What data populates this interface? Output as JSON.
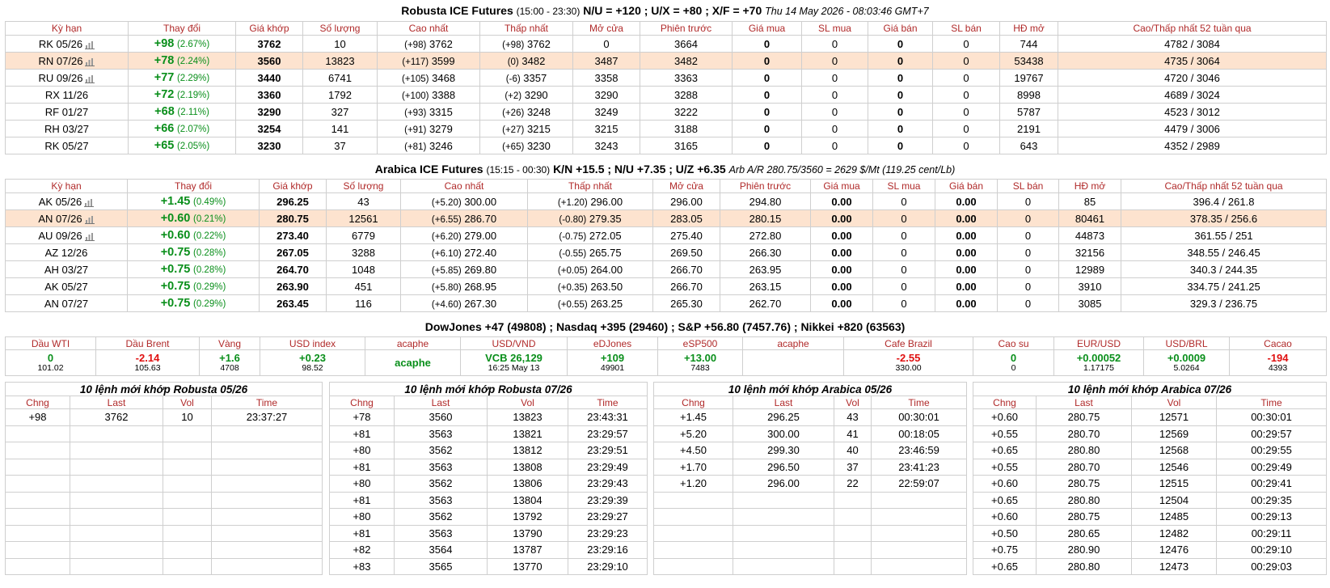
{
  "robusta": {
    "title_main": "Robusta ICE Futures",
    "title_hours": "(15:00 - 23:30)",
    "title_spreads": "N/U = +120 ; U/X = +80 ; X/F = +70",
    "title_time": "Thu 14 May 2026 - 08:03:46 GMT+7",
    "headers": [
      "Kỳ hạn",
      "Thay đổi",
      "Giá khớp",
      "Số lượng",
      "Cao nhất",
      "Thấp nhất",
      "Mở cửa",
      "Phiên trước",
      "Giá mua",
      "SL mua",
      "Giá bán",
      "SL bán",
      "HĐ mở",
      "Cao/Thấp nhất 52 tuần qua"
    ],
    "rows": [
      {
        "term": "RK 05/26",
        "chart": true,
        "chg": "+98",
        "pct": "(2.67%)",
        "price": "3762",
        "vol": "10",
        "high_chg": "(+98)",
        "high": "3762",
        "low_chg": "(+98)",
        "low": "3762",
        "open": "0",
        "prev": "3664",
        "bid": "0",
        "bid_qty": "0",
        "ask": "0",
        "ask_qty": "0",
        "oi": "744",
        "range52": "4782 / 3084",
        "hl": false
      },
      {
        "term": "RN 07/26",
        "chart": true,
        "chg": "+78",
        "pct": "(2.24%)",
        "price": "3560",
        "vol": "13823",
        "high_chg": "(+117)",
        "high": "3599",
        "low_chg": "(0)",
        "low": "3482",
        "open": "3487",
        "prev": "3482",
        "bid": "0",
        "bid_qty": "0",
        "ask": "0",
        "ask_qty": "0",
        "oi": "53438",
        "range52": "4735 / 3064",
        "hl": true
      },
      {
        "term": "RU 09/26",
        "chart": true,
        "chg": "+77",
        "pct": "(2.29%)",
        "price": "3440",
        "vol": "6741",
        "high_chg": "(+105)",
        "high": "3468",
        "low_chg": "(-6)",
        "low": "3357",
        "open": "3358",
        "prev": "3363",
        "bid": "0",
        "bid_qty": "0",
        "ask": "0",
        "ask_qty": "0",
        "oi": "19767",
        "range52": "4720 / 3046",
        "hl": false
      },
      {
        "term": "RX 11/26",
        "chart": false,
        "chg": "+72",
        "pct": "(2.19%)",
        "price": "3360",
        "vol": "1792",
        "high_chg": "(+100)",
        "high": "3388",
        "low_chg": "(+2)",
        "low": "3290",
        "open": "3290",
        "prev": "3288",
        "bid": "0",
        "bid_qty": "0",
        "ask": "0",
        "ask_qty": "0",
        "oi": "8998",
        "range52": "4689 / 3024",
        "hl": false
      },
      {
        "term": "RF 01/27",
        "chart": false,
        "chg": "+68",
        "pct": "(2.11%)",
        "price": "3290",
        "vol": "327",
        "high_chg": "(+93)",
        "high": "3315",
        "low_chg": "(+26)",
        "low": "3248",
        "open": "3249",
        "prev": "3222",
        "bid": "0",
        "bid_qty": "0",
        "ask": "0",
        "ask_qty": "0",
        "oi": "5787",
        "range52": "4523 / 3012",
        "hl": false
      },
      {
        "term": "RH 03/27",
        "chart": false,
        "chg": "+66",
        "pct": "(2.07%)",
        "price": "3254",
        "vol": "141",
        "high_chg": "(+91)",
        "high": "3279",
        "low_chg": "(+27)",
        "low": "3215",
        "open": "3215",
        "prev": "3188",
        "bid": "0",
        "bid_qty": "0",
        "ask": "0",
        "ask_qty": "0",
        "oi": "2191",
        "range52": "4479 / 3006",
        "hl": false
      },
      {
        "term": "RK 05/27",
        "chart": false,
        "chg": "+65",
        "pct": "(2.05%)",
        "price": "3230",
        "vol": "37",
        "high_chg": "(+81)",
        "high": "3246",
        "low_chg": "(+65)",
        "low": "3230",
        "open": "3243",
        "prev": "3165",
        "bid": "0",
        "bid_qty": "0",
        "ask": "0",
        "ask_qty": "0",
        "oi": "643",
        "range52": "4352 / 2989",
        "hl": false
      }
    ]
  },
  "arabica": {
    "title_main": "Arabica ICE Futures",
    "title_hours": "(15:15 - 00:30)",
    "title_spreads": "K/N +15.5 ; N/U +7.35 ; U/Z +6.35",
    "title_note": "Arb A/R 280.75/3560 = 2629 $/Mt (119.25 cent/Lb)",
    "headers": [
      "Kỳ hạn",
      "Thay đổi",
      "Giá khớp",
      "Số lượng",
      "Cao nhất",
      "Thấp nhất",
      "Mở cửa",
      "Phiên trước",
      "Giá mua",
      "SL mua",
      "Giá bán",
      "SL bán",
      "HĐ mở",
      "Cao/Thấp nhất 52 tuần qua"
    ],
    "rows": [
      {
        "term": "AK 05/26",
        "chart": true,
        "chg": "+1.45",
        "pct": "(0.49%)",
        "price": "296.25",
        "vol": "43",
        "high_chg": "(+5.20)",
        "high": "300.00",
        "low_chg": "(+1.20)",
        "low": "296.00",
        "open": "296.00",
        "prev": "294.80",
        "bid": "0.00",
        "bid_qty": "0",
        "ask": "0.00",
        "ask_qty": "0",
        "oi": "85",
        "range52": "396.4 / 261.8",
        "hl": false
      },
      {
        "term": "AN 07/26",
        "chart": true,
        "chg": "+0.60",
        "pct": "(0.21%)",
        "price": "280.75",
        "vol": "12561",
        "high_chg": "(+6.55)",
        "high": "286.70",
        "low_chg": "(-0.80)",
        "low": "279.35",
        "open": "283.05",
        "prev": "280.15",
        "bid": "0.00",
        "bid_qty": "0",
        "ask": "0.00",
        "ask_qty": "0",
        "oi": "80461",
        "range52": "378.35 / 256.6",
        "hl": true
      },
      {
        "term": "AU 09/26",
        "chart": true,
        "chg": "+0.60",
        "pct": "(0.22%)",
        "price": "273.40",
        "vol": "6779",
        "high_chg": "(+6.20)",
        "high": "279.00",
        "low_chg": "(-0.75)",
        "low": "272.05",
        "open": "275.40",
        "prev": "272.80",
        "bid": "0.00",
        "bid_qty": "0",
        "ask": "0.00",
        "ask_qty": "0",
        "oi": "44873",
        "range52": "361.55 / 251",
        "hl": false
      },
      {
        "term": "AZ 12/26",
        "chart": false,
        "chg": "+0.75",
        "pct": "(0.28%)",
        "price": "267.05",
        "vol": "3288",
        "high_chg": "(+6.10)",
        "high": "272.40",
        "low_chg": "(-0.55)",
        "low": "265.75",
        "open": "269.50",
        "prev": "266.30",
        "bid": "0.00",
        "bid_qty": "0",
        "ask": "0.00",
        "ask_qty": "0",
        "oi": "32156",
        "range52": "348.55 / 246.45",
        "hl": false
      },
      {
        "term": "AH 03/27",
        "chart": false,
        "chg": "+0.75",
        "pct": "(0.28%)",
        "price": "264.70",
        "vol": "1048",
        "high_chg": "(+5.85)",
        "high": "269.80",
        "low_chg": "(+0.05)",
        "low": "264.00",
        "open": "266.70",
        "prev": "263.95",
        "bid": "0.00",
        "bid_qty": "0",
        "ask": "0.00",
        "ask_qty": "0",
        "oi": "12989",
        "range52": "340.3 / 244.35",
        "hl": false
      },
      {
        "term": "AK 05/27",
        "chart": false,
        "chg": "+0.75",
        "pct": "(0.29%)",
        "price": "263.90",
        "vol": "451",
        "high_chg": "(+5.80)",
        "high": "268.95",
        "low_chg": "(+0.35)",
        "low": "263.50",
        "open": "266.70",
        "prev": "263.15",
        "bid": "0.00",
        "bid_qty": "0",
        "ask": "0.00",
        "ask_qty": "0",
        "oi": "3910",
        "range52": "334.75 / 241.25",
        "hl": false
      },
      {
        "term": "AN 07/27",
        "chart": false,
        "chg": "+0.75",
        "pct": "(0.29%)",
        "price": "263.45",
        "vol": "116",
        "high_chg": "(+4.60)",
        "high": "267.30",
        "low_chg": "(+0.55)",
        "low": "263.25",
        "open": "265.30",
        "prev": "262.70",
        "bid": "0.00",
        "bid_qty": "0",
        "ask": "0.00",
        "ask_qty": "0",
        "oi": "3085",
        "range52": "329.3 / 236.75",
        "hl": false
      }
    ]
  },
  "indices_title": "DowJones +47 (49808) ; Nasdaq +395 (29460) ; S&P +56.80 (7457.76) ; Nikkei +820 (63563)",
  "markets": [
    {
      "name": "Dầu WTI",
      "v": "0",
      "s": "101.02",
      "dir": "up"
    },
    {
      "name": "Dầu Brent",
      "v": "-2.14",
      "s": "105.63",
      "dir": "dn"
    },
    {
      "name": "Vàng",
      "v": "+1.6",
      "s": "4708",
      "dir": "up"
    },
    {
      "name": "USD index",
      "v": "+0.23",
      "s": "98.52",
      "dir": "up"
    },
    {
      "name": "acaphe",
      "v": "acaphe",
      "s": "",
      "dir": "up"
    },
    {
      "name": "USD/VND",
      "v": "VCB 26,129",
      "s": "16:25 May 13",
      "dir": "up"
    },
    {
      "name": "eDJones",
      "v": "+109",
      "s": "49901",
      "dir": "up"
    },
    {
      "name": "eSP500",
      "v": "+13.00",
      "s": "7483",
      "dir": "up"
    },
    {
      "name": "acaphe",
      "v": "",
      "s": "",
      "dir": "up"
    },
    {
      "name": "Cafe Brazil",
      "v": "-2.55",
      "s": "330.00",
      "dir": "dn"
    },
    {
      "name": "Cao su",
      "v": "0",
      "s": "0",
      "dir": "up"
    },
    {
      "name": "EUR/USD",
      "v": "+0.00052",
      "s": "1.17175",
      "dir": "up"
    },
    {
      "name": "USD/BRL",
      "v": "+0.0009",
      "s": "5.0264",
      "dir": "up"
    },
    {
      "name": "Cacao",
      "v": "-194",
      "s": "4393",
      "dir": "dn"
    }
  ],
  "trades": {
    "headers": [
      "Chng",
      "Last",
      "Vol",
      "Time"
    ],
    "panels": [
      {
        "title": "10 lệnh mới khớp Robusta 05/26",
        "rows": [
          [
            "+98",
            "3762",
            "10",
            "23:37:27"
          ]
        ]
      },
      {
        "title": "10 lệnh mới khớp Robusta 07/26",
        "rows": [
          [
            "+78",
            "3560",
            "13823",
            "23:43:31"
          ],
          [
            "+81",
            "3563",
            "13821",
            "23:29:57"
          ],
          [
            "+80",
            "3562",
            "13812",
            "23:29:51"
          ],
          [
            "+81",
            "3563",
            "13808",
            "23:29:49"
          ],
          [
            "+80",
            "3562",
            "13806",
            "23:29:43"
          ],
          [
            "+81",
            "3563",
            "13804",
            "23:29:39"
          ],
          [
            "+80",
            "3562",
            "13792",
            "23:29:27"
          ],
          [
            "+81",
            "3563",
            "13790",
            "23:29:23"
          ],
          [
            "+82",
            "3564",
            "13787",
            "23:29:16"
          ],
          [
            "+83",
            "3565",
            "13770",
            "23:29:10"
          ]
        ]
      },
      {
        "title": "10 lệnh mới khớp Arabica 05/26",
        "rows": [
          [
            "+1.45",
            "296.25",
            "43",
            "00:30:01"
          ],
          [
            "+5.20",
            "300.00",
            "41",
            "00:18:05"
          ],
          [
            "+4.50",
            "299.30",
            "40",
            "23:46:59"
          ],
          [
            "+1.70",
            "296.50",
            "37",
            "23:41:23"
          ],
          [
            "+1.20",
            "296.00",
            "22",
            "22:59:07"
          ]
        ]
      },
      {
        "title": "10 lệnh mới khớp Arabica 07/26",
        "rows": [
          [
            "+0.60",
            "280.75",
            "12571",
            "00:30:01"
          ],
          [
            "+0.55",
            "280.70",
            "12569",
            "00:29:57"
          ],
          [
            "+0.65",
            "280.80",
            "12568",
            "00:29:55"
          ],
          [
            "+0.55",
            "280.70",
            "12546",
            "00:29:49"
          ],
          [
            "+0.60",
            "280.75",
            "12515",
            "00:29:41"
          ],
          [
            "+0.65",
            "280.80",
            "12504",
            "00:29:35"
          ],
          [
            "+0.60",
            "280.75",
            "12485",
            "00:29:13"
          ],
          [
            "+0.50",
            "280.65",
            "12482",
            "00:29:11"
          ],
          [
            "+0.75",
            "280.90",
            "12476",
            "00:29:10"
          ],
          [
            "+0.65",
            "280.80",
            "12473",
            "00:29:03"
          ]
        ]
      }
    ]
  }
}
